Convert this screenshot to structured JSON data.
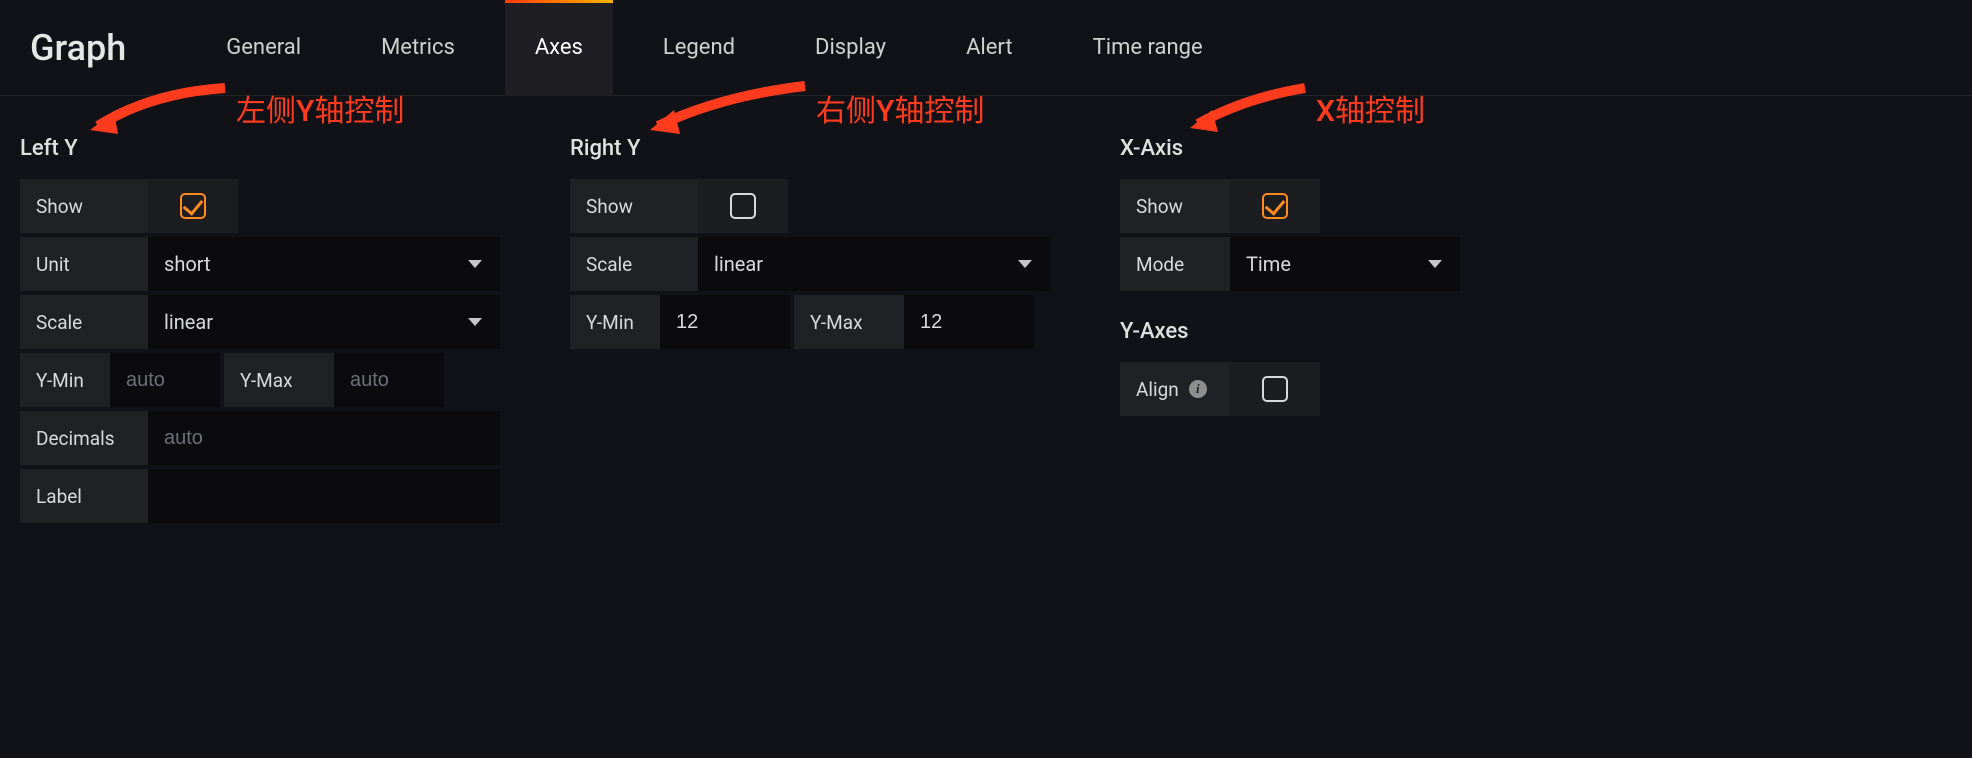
{
  "title": "Graph",
  "tabs": {
    "general": "General",
    "metrics": "Metrics",
    "axes": "Axes",
    "legend": "Legend",
    "display": "Display",
    "alert": "Alert",
    "timerange": "Time range"
  },
  "leftY": {
    "heading": "Left Y",
    "show_label": "Show",
    "show_checked": true,
    "unit_label": "Unit",
    "unit_value": "short",
    "scale_label": "Scale",
    "scale_value": "linear",
    "ymin_label": "Y-Min",
    "ymin_placeholder": "auto",
    "ymin_value": "",
    "ymax_label": "Y-Max",
    "ymax_placeholder": "auto",
    "ymax_value": "",
    "decimals_label": "Decimals",
    "decimals_placeholder": "auto",
    "decimals_value": "",
    "label_label": "Label",
    "label_value": ""
  },
  "rightY": {
    "heading": "Right Y",
    "show_label": "Show",
    "show_checked": false,
    "scale_label": "Scale",
    "scale_value": "linear",
    "ymin_label": "Y-Min",
    "ymin_value": "12",
    "ymax_label": "Y-Max",
    "ymax_value": "12"
  },
  "xAxis": {
    "heading": "X-Axis",
    "show_label": "Show",
    "show_checked": true,
    "mode_label": "Mode",
    "mode_value": "Time"
  },
  "yAxes": {
    "heading": "Y-Axes",
    "align_label": "Align",
    "align_checked": false
  },
  "annotations": {
    "leftY": "左侧Y轴控制",
    "rightY": "右侧Y轴控制",
    "xAxis": "X轴控制"
  }
}
